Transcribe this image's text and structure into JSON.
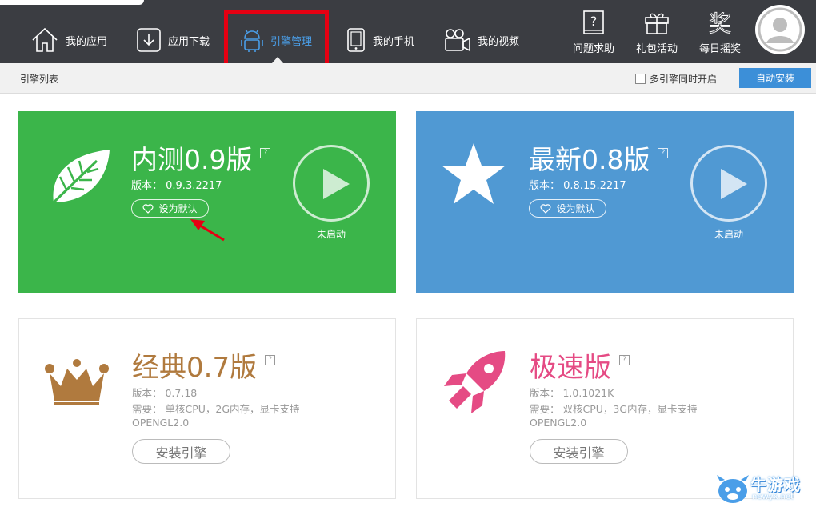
{
  "nav": {
    "items": [
      {
        "label": "我的应用",
        "icon": "home-icon"
      },
      {
        "label": "应用下载",
        "icon": "download-icon"
      },
      {
        "label": "引擎管理",
        "icon": "android-icon"
      },
      {
        "label": "我的手机",
        "icon": "phone-icon"
      },
      {
        "label": "我的视频",
        "icon": "video-camera-icon"
      }
    ],
    "active_index": 2,
    "right_items": [
      {
        "label": "问题求助",
        "icon": "question-book-icon"
      },
      {
        "label": "礼包活动",
        "icon": "gift-icon"
      },
      {
        "label": "每日摇奖",
        "icon": "lottery-icon"
      }
    ]
  },
  "subbar": {
    "title": "引擎列表",
    "checkbox_label": "多引擎同时开启",
    "checkbox_checked": false,
    "auto_install_label": "自动安装"
  },
  "engines": [
    {
      "title": "内测0.9版",
      "help": "?",
      "version": "版本： 0.9.3.2217",
      "default_label": "设为默认",
      "status": "未启动",
      "bg": "#3bb54a",
      "icon": "leaf-icon"
    },
    {
      "title": "最新0.8版",
      "help": "?",
      "version": "版本： 0.8.15.2217",
      "default_label": "设为默认",
      "status": "未启动",
      "bg": "#5099d3",
      "icon": "star-icon"
    },
    {
      "title": "经典0.7版",
      "help": "?",
      "version": "版本： 0.7.18",
      "requirement_1": "需要： 单核CPU，2G内存，显卡支持",
      "requirement_2": "OPENGL2.0",
      "install_label": "安装引擎",
      "title_color": "#b07a3e",
      "icon": "crown-icon"
    },
    {
      "title": "极速版",
      "help": "?",
      "version": "版本： 1.0.1021K",
      "requirement_1": "需要： 双核CPU，3G内存，显卡支持",
      "requirement_2": "OPENGL2.0",
      "install_label": "安装引擎",
      "title_color": "#e54b84",
      "icon": "rocket-icon"
    }
  ],
  "watermark": {
    "text": "牛游戏",
    "url": "newyx.net"
  },
  "colors": {
    "topbar": "#3b3d42",
    "accent": "#4a9ee8",
    "highlight_frame": "#e60012"
  }
}
